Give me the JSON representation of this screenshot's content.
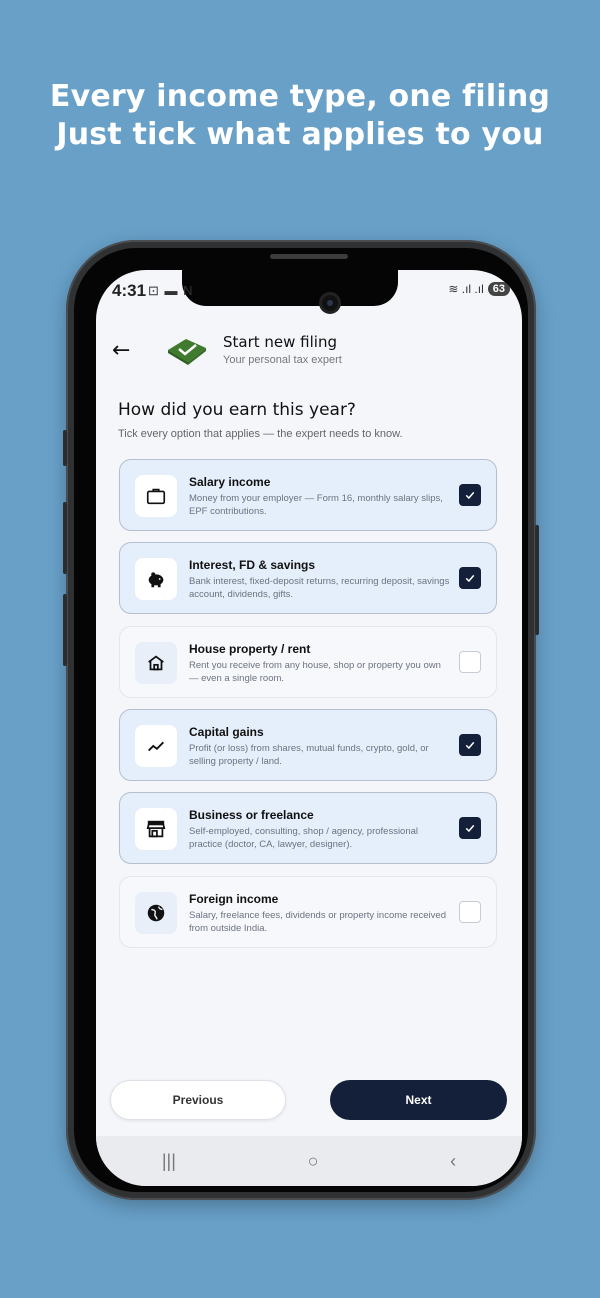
{
  "headline": {
    "line1": "Every income type, one filing",
    "line2": "Just tick what applies to you"
  },
  "status_bar": {
    "time": "4:31",
    "left_icons": "⊡ ▬ N",
    "signal": "≋ .ıl .ıl",
    "battery": "63"
  },
  "header": {
    "back_icon": "arrow-left-icon",
    "title": "Start new filing",
    "subtitle": "Your personal tax expert"
  },
  "question": {
    "title": "How did you earn this year?",
    "hint": "Tick every option that applies — the expert needs to know."
  },
  "options": [
    {
      "icon": "briefcase-icon",
      "title": "Salary income",
      "description": "Money from your employer — Form 16, monthly salary slips, EPF contributions.",
      "checked": true
    },
    {
      "icon": "piggy-bank-icon",
      "title": "Interest, FD & savings",
      "description": "Bank interest, fixed-deposit returns, recurring deposit, savings account, dividends, gifts.",
      "checked": true
    },
    {
      "icon": "house-icon",
      "title": "House property / rent",
      "description": "Rent you receive from any house, shop or property you own — even a single room.",
      "checked": false
    },
    {
      "icon": "trend-up-icon",
      "title": "Capital gains",
      "description": "Profit (or loss) from shares, mutual funds, crypto, gold, or selling property / land.",
      "checked": true
    },
    {
      "icon": "storefront-icon",
      "title": "Business or freelance",
      "description": "Self-employed, consulting, shop / agency, professional practice (doctor, CA, lawyer, designer).",
      "checked": true
    },
    {
      "icon": "globe-icon",
      "title": "Foreign income",
      "description": "Salary, freelance fees, dividends or property income received from outside India.",
      "checked": false
    }
  ],
  "buttons": {
    "previous": "Previous",
    "next": "Next"
  },
  "navbar": {
    "recents": "|||",
    "home": "○",
    "back": "‹"
  },
  "colors": {
    "background": "#68a0c8",
    "accent_dark": "#14203a",
    "selected_card": "#e5eefb",
    "logo_green": "#4e8a3a"
  }
}
